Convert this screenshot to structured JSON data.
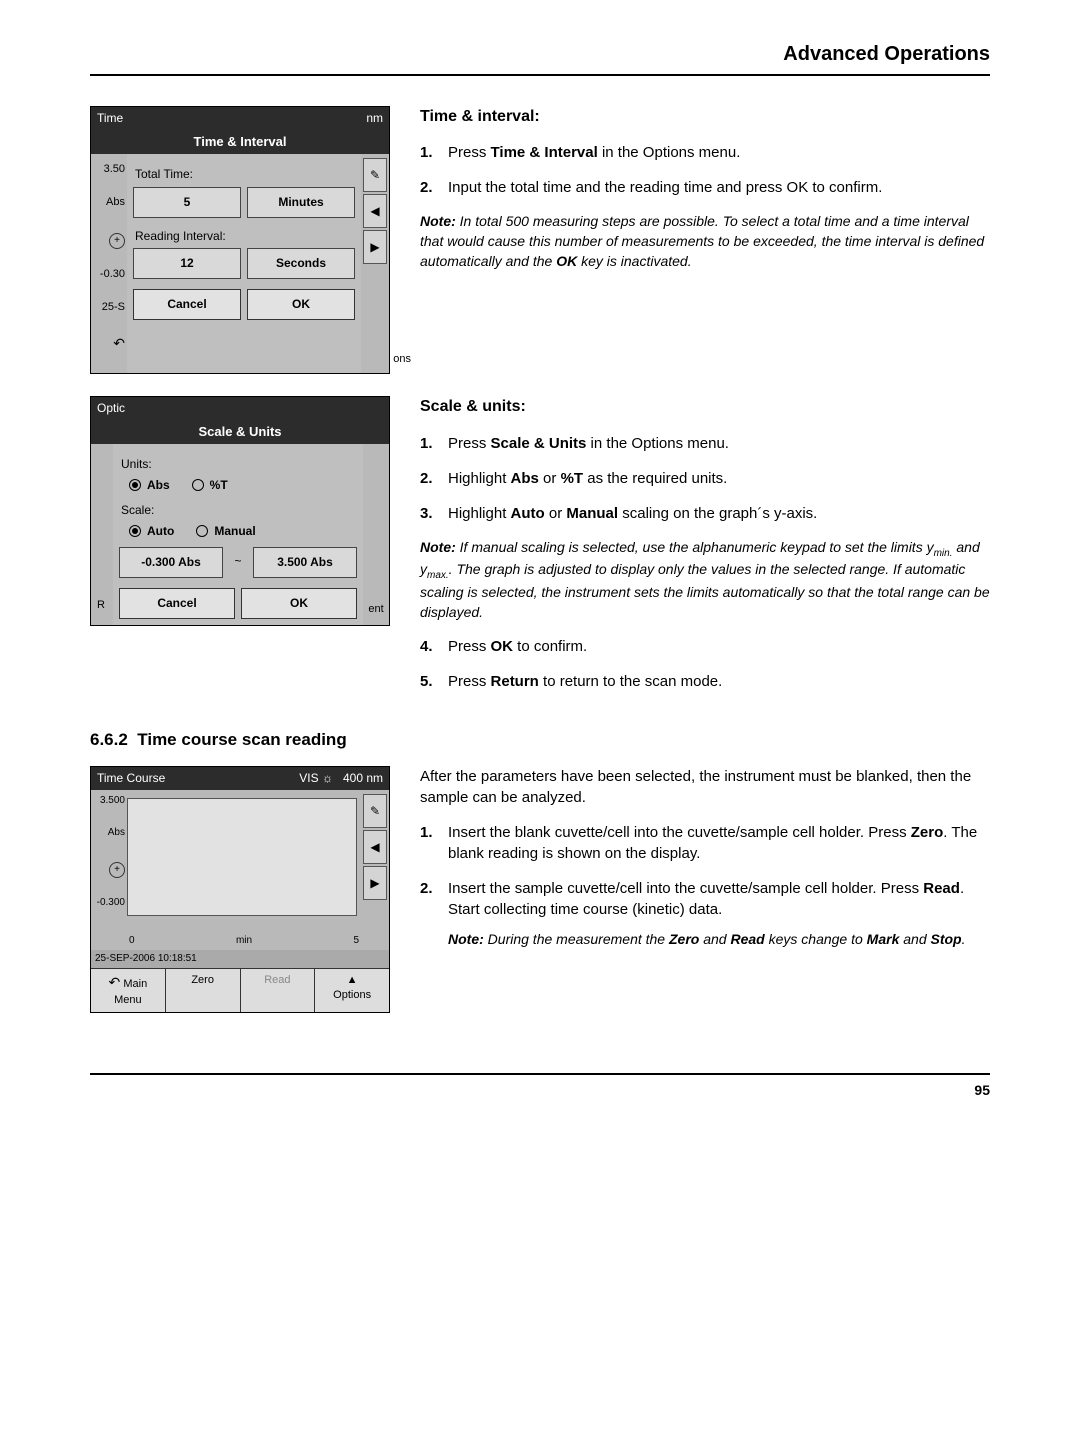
{
  "header_title": "Advanced Operations",
  "page_number": "95",
  "screenshots": {
    "time_interval": {
      "bg_app": "Time",
      "bg_nm": "nm",
      "dialog_title": "Time & Interval",
      "total_time_label": "Total Time:",
      "total_time_value": "5",
      "total_time_unit": "Minutes",
      "reading_interval_label": "Reading Interval:",
      "reading_interval_value": "12",
      "reading_interval_unit": "Seconds",
      "cancel": "Cancel",
      "ok": "OK",
      "axis_top": "3.50",
      "axis_mid": "Abs",
      "axis_bot": "-0.30",
      "axis_lowest": "25-S",
      "ons_fragment": "ons"
    },
    "scale_units": {
      "bg_app": "Optic",
      "dialog_title": "Scale & Units",
      "units_label": "Units:",
      "unit_abs": "Abs",
      "unit_pt": "%T",
      "scale_label": "Scale:",
      "scale_auto": "Auto",
      "scale_manual": "Manual",
      "min_val": "-0.300 Abs",
      "tilde": "~",
      "max_val": "3.500 Abs",
      "cancel": "Cancel",
      "ok": "OK",
      "ent_fragment": "ent",
      "r_fragment": "R"
    },
    "time_course": {
      "title": "Time Course",
      "vis": "VIS ☼",
      "wavelength": "400 nm",
      "y_top": "3.500",
      "y_mid": "Abs",
      "y_bot": "-0.300",
      "x_left": "0",
      "x_mid": "min",
      "x_right": "5",
      "status": "25-SEP-2006  10:18:51",
      "b_mainmenu_l1": "Main",
      "b_mainmenu_l2": "Menu",
      "b_zero": "Zero",
      "b_read": "Read",
      "b_options": "Options"
    }
  },
  "sections": {
    "time_interval": {
      "heading": "Time & interval:",
      "items": [
        {
          "num": "1.",
          "pre": "Press ",
          "bold": "Time & Interval",
          "post": " in the Options menu."
        },
        {
          "num": "2.",
          "text": "Input the total time and the reading time and press OK to confirm."
        }
      ],
      "note_prefix": "Note:",
      "note_body": " In total 500 measuring steps are possible. To select a total time and a time interval that would cause this number of measurements to be exceeded, the time interval is defined automatically and the ",
      "note_bold": "OK",
      "note_tail": " key is inactivated."
    },
    "scale_units": {
      "heading": "Scale & units:",
      "items": [
        {
          "num": "1.",
          "pre": "Press ",
          "bold": "Scale & Units",
          "post": " in the Options menu."
        },
        {
          "num": "2.",
          "pre": "Highlight ",
          "bold": "Abs",
          "mid": " or ",
          "bold2": "%T",
          "post": " as the required units."
        },
        {
          "num": "3.",
          "pre": "Highlight ",
          "bold": "Auto",
          "mid": " or ",
          "bold2": "Manual",
          "post": " scaling on the graph´s y-axis."
        }
      ],
      "note_prefix": "Note:",
      "note_body1": " If manual scaling is selected, use the alphanumeric keypad to set the limits y",
      "note_sub1": "min.",
      "note_body2": " and y",
      "note_sub2": "max.",
      "note_body3": ". The graph is adjusted to display only the values in the selected range. If automatic scaling is selected, the instrument sets the limits automatically so that the total range can be displayed.",
      "items_after": [
        {
          "num": "4.",
          "pre": "Press ",
          "bold": "OK",
          "post": " to confirm."
        },
        {
          "num": "5.",
          "pre": "Press ",
          "bold": "Return",
          "post": " to return to the scan mode."
        }
      ]
    },
    "time_course_reading": {
      "section_number": "6.6.2",
      "section_title": "Time course scan reading",
      "intro": "After the parameters have been selected, the instrument must be blanked, then the sample can be analyzed.",
      "items": [
        {
          "num": "1.",
          "pre": "Insert the blank cuvette/cell into the cuvette/sample cell holder. Press ",
          "bold": "Zero",
          "post": ". The blank reading is shown on the display."
        },
        {
          "num": "2.",
          "pre": "Insert the sample cuvette/cell into the cuvette/sample cell holder. Press ",
          "bold": "Read",
          "post": ". Start collecting time course (kinetic) data."
        }
      ],
      "note_prefix": "Note:",
      "note_body1": " During the measurement the ",
      "note_bold1": "Zero",
      "note_body2": " and ",
      "note_bold2": "Read",
      "note_body3": " keys change to ",
      "note_bold3": "Mark",
      "note_body4": " and ",
      "note_bold4": "Stop",
      "note_body5": "."
    }
  }
}
